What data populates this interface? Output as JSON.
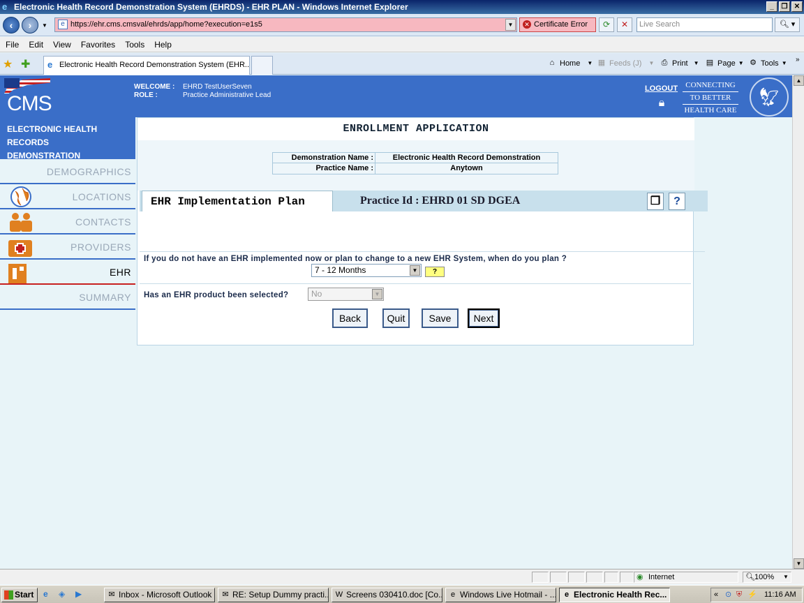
{
  "window": {
    "title": "Electronic Health Record Demonstration System (EHRDS) - EHR PLAN - Windows Internet Explorer"
  },
  "browser": {
    "url": "https://ehr.cms.cmsval/ehrds/app/home?execution=e1s5",
    "cert_error": "Certificate Error",
    "search_placeholder": "Live Search",
    "menu": [
      "File",
      "Edit",
      "View",
      "Favorites",
      "Tools",
      "Help"
    ],
    "tab_title": "Electronic Health Record Demonstration System (EHR...",
    "commands": {
      "home": "Home",
      "feeds": "Feeds (J)",
      "print": "Print",
      "page": "Page",
      "tools": "Tools"
    },
    "status": {
      "zone": "Internet",
      "zoom": "100%"
    }
  },
  "header": {
    "logo_text": "CMS",
    "welcome_label": "WELCOME :",
    "welcome_value": "EHRD TestUserSeven",
    "role_label": "ROLE :",
    "role_value": "Practice Administrative Lead",
    "logout": "LOGOUT",
    "tagline": [
      "CONNECTING",
      "TO BETTER",
      "HEALTH CARE"
    ]
  },
  "sidebar": {
    "title_line1": "ELECTRONIC HEALTH RECORDS",
    "title_line2": "DEMONSTRATION",
    "items": [
      {
        "label": "DEMOGRAPHICS",
        "active": false
      },
      {
        "label": "LOCATIONS",
        "active": false
      },
      {
        "label": "CONTACTS",
        "active": false
      },
      {
        "label": "PROVIDERS",
        "active": false
      },
      {
        "label": "EHR",
        "active": true
      },
      {
        "label": "SUMMARY",
        "active": false
      }
    ]
  },
  "main": {
    "title": "ENROLLMENT APPLICATION",
    "demo_name_label": "Demonstration Name :",
    "demo_name_value": "Electronic Health Record Demonstration",
    "practice_name_label": "Practice Name :",
    "practice_name_value": "Anytown",
    "section_tab": "EHR Implementation Plan",
    "practice_id": "Practice Id : EHRD 01 SD DGEA",
    "question1": "If you do not have an EHR implemented now or plan to change to a new EHR System, when do you plan ?",
    "question1_value": "7 - 12 Months",
    "help_label": "?",
    "question2": "Has an EHR product been selected?",
    "question2_value": "No",
    "buttons": {
      "back": "Back",
      "quit": "Quit",
      "save": "Save",
      "next": "Next"
    }
  },
  "taskbar": {
    "start": "Start",
    "items": [
      "Inbox - Microsoft Outlook",
      "RE: Setup Dummy practi...",
      "Screens 030410.doc [Co...",
      "Windows Live Hotmail - ...",
      "Electronic Health Rec..."
    ],
    "clock": "11:16 AM"
  }
}
